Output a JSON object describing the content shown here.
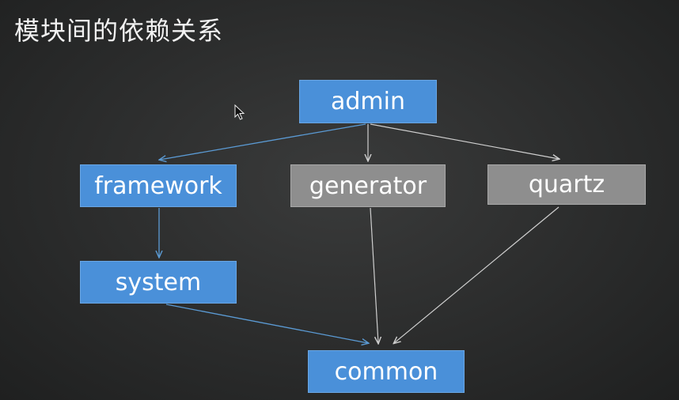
{
  "title": "模块间的依赖关系",
  "nodes": {
    "admin": "admin",
    "framework": "framework",
    "generator": "generator",
    "quartz": "quartz",
    "system": "system",
    "common": "common"
  },
  "colors": {
    "module_blue": "#4a90d9",
    "module_gray": "#8e8e8e",
    "edge_blue": "#5b9bd5",
    "edge_gray": "#cfcfcf",
    "background": "#2b2c2c"
  },
  "edges": [
    {
      "from": "admin",
      "to": "framework",
      "style": "blue"
    },
    {
      "from": "admin",
      "to": "generator",
      "style": "gray"
    },
    {
      "from": "admin",
      "to": "quartz",
      "style": "gray"
    },
    {
      "from": "framework",
      "to": "system",
      "style": "blue"
    },
    {
      "from": "system",
      "to": "common",
      "style": "blue"
    },
    {
      "from": "generator",
      "to": "common",
      "style": "gray"
    },
    {
      "from": "quartz",
      "to": "common",
      "style": "gray"
    }
  ],
  "icons": {
    "cursor": "mouse-pointer-icon"
  }
}
